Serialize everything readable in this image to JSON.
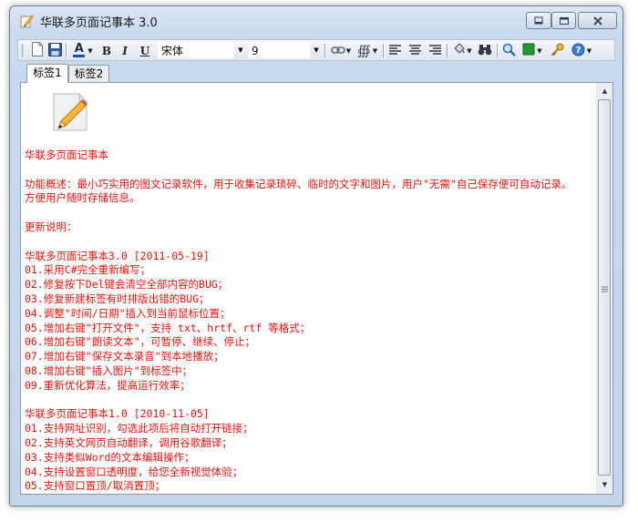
{
  "window": {
    "title": "华联多页面记事本 3.0"
  },
  "toolbar": {
    "font_name": "宋体",
    "font_size": "9",
    "bold_label": "B",
    "italic_label": "I",
    "underline_label": "U",
    "font_color_label": "A"
  },
  "tabs": [
    {
      "label": "标签1",
      "active": true
    },
    {
      "label": "标签2",
      "active": false
    }
  ],
  "editor": {
    "lines": [
      "华联多页面记事本",
      "",
      "功能概述：最小巧实用的图文记录软件，用于收集记录琐碎、临时的文字和图片，用户\"无需\"自己保存便可自动记录。",
      "方便用户随时存储信息。",
      "",
      "更新说明：",
      "",
      "华联多页面记事本3.0   [2011-05-19]",
      "01.采用C#完全重新编写；",
      "02.修复按下Del键会清空全部内容的BUG；",
      "03.修复新建标签有时排版出错的BUG；",
      "04.调整\"时间/日期\"插入到当前鼠标位置；",
      "05.增加右键\"打开文件\"，支持 txt、hrtf、rtf 等格式；",
      "06.增加右键\"朗读文本\"，可暂停、继续、停止；",
      "07.增加右键\"保存文本录音\"到本地播放；",
      "08.增加右键\"插入图片\"到标签中；",
      "09.重新优化算法，提高运行效率；",
      "",
      "华联多页面记事本1.0   [2010-11-05]",
      "01.支持网址识别，勾选此项后将自动打开链接；",
      "02.支持英文网页自动翻译，调用谷歌翻译；",
      "03.支持类似Word的文本编辑操作；",
      "04.支持设置窗口透明度，给您全新视觉体验；",
      "05.支持窗口置顶/取消置顶；"
    ]
  },
  "colors": {
    "text": "#e8120c",
    "window_frame": "#c4d5ea"
  }
}
